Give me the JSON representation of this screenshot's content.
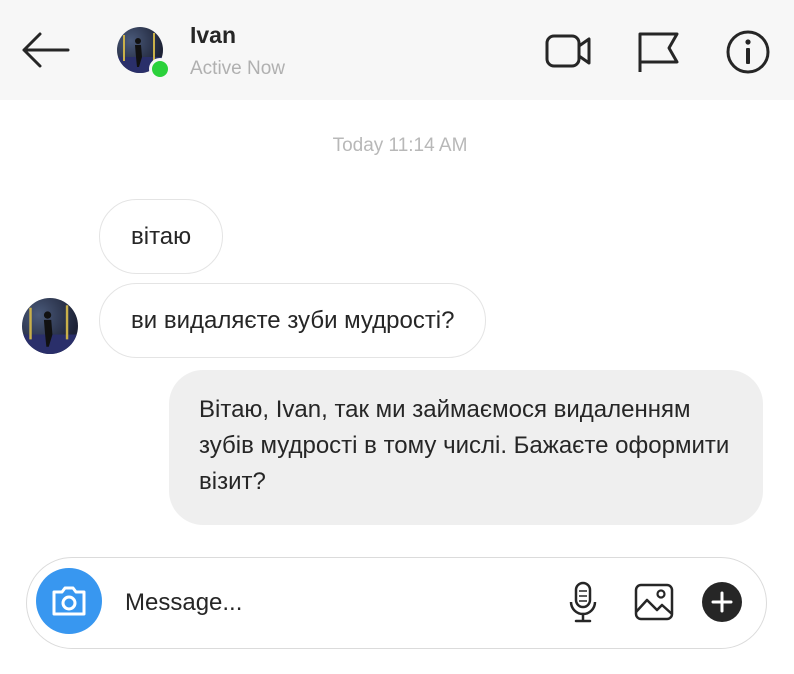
{
  "header": {
    "contact_name": "Ivan",
    "status": "Active Now",
    "icons": [
      "back-arrow-icon",
      "video-camera-icon",
      "flag-icon",
      "info-icon"
    ]
  },
  "conversation": {
    "timestamp": "Today 11:14 AM",
    "incoming": [
      {
        "text": "вітаю"
      },
      {
        "text": "ви видаляєте зуби мудрості?"
      }
    ],
    "outgoing": [
      {
        "text": "Вітаю, Ivan, так ми займаємося видаленням зубів мудрості в тому числі. Бажаєте оформити візит?"
      }
    ]
  },
  "composer": {
    "placeholder": "Message...",
    "value": "",
    "icons": [
      "camera-icon",
      "microphone-icon",
      "image-icon",
      "plus-icon"
    ]
  },
  "colors": {
    "header_bg": "#f7f7f7",
    "online": "#2bd13b",
    "camera_button": "#3897f0",
    "outgoing_bubble": "#efefef",
    "incoming_border": "#e4e4e4"
  }
}
